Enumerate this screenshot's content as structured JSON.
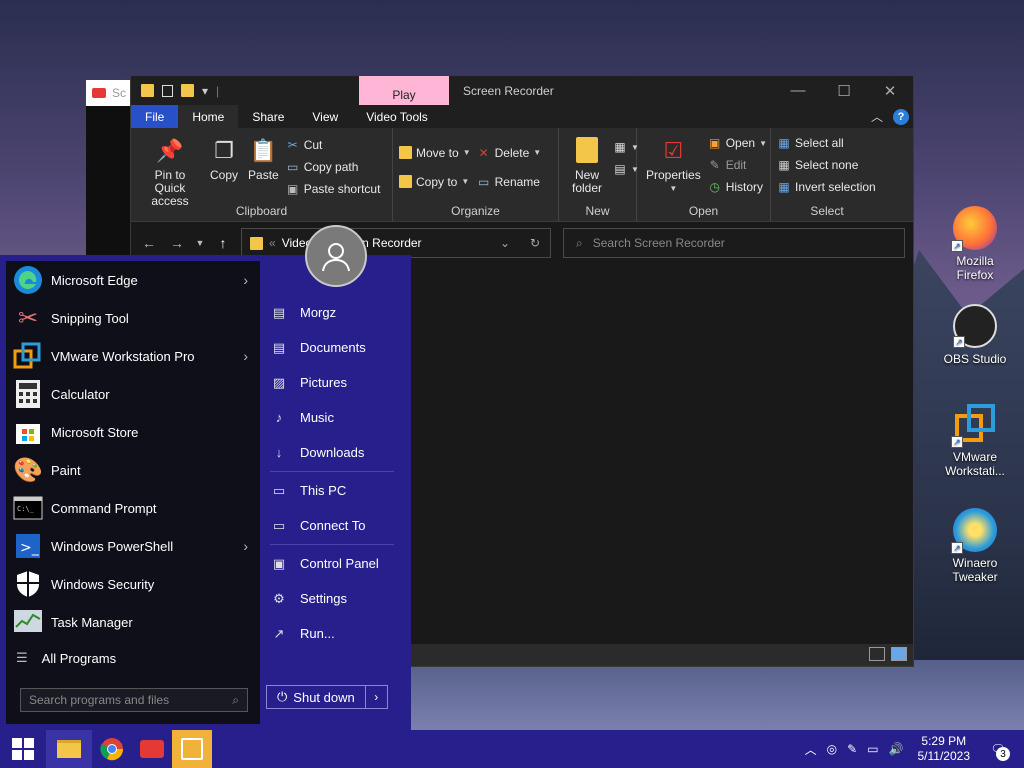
{
  "background_window": {
    "title": "Sc"
  },
  "explorer": {
    "title": "Screen Recorder",
    "context_tab": "Play",
    "tabs": {
      "file": "File",
      "home": "Home",
      "share": "Share",
      "view": "View",
      "video_tools": "Video Tools"
    },
    "clipboard": {
      "pin": "Pin to Quick access",
      "copy": "Copy",
      "paste": "Paste",
      "cut": "Cut",
      "copy_path": "Copy path",
      "paste_shortcut": "Paste shortcut",
      "label": "Clipboard"
    },
    "organize": {
      "move_to": "Move to",
      "copy_to": "Copy to",
      "delete": "Delete",
      "rename": "Rename",
      "label": "Organize"
    },
    "new": {
      "new_folder": "New folder",
      "label": "New"
    },
    "open": {
      "properties": "Properties",
      "open": "Open",
      "edit": "Edit",
      "history": "History",
      "label": "Open"
    },
    "select": {
      "select_all": "Select all",
      "select_none": "Select none",
      "invert_selection": "Invert selection",
      "label": "Select"
    },
    "address": {
      "part1": "Video",
      "part2": "n Recorder"
    },
    "search_placeholder": "Search Screen Recorder"
  },
  "start_menu": {
    "apps": [
      {
        "label": "Microsoft Edge",
        "submenu": true
      },
      {
        "label": "Snipping Tool",
        "submenu": false
      },
      {
        "label": "VMware Workstation Pro",
        "submenu": true
      },
      {
        "label": "Calculator",
        "submenu": false
      },
      {
        "label": "Microsoft Store",
        "submenu": false
      },
      {
        "label": "Paint",
        "submenu": false
      },
      {
        "label": "Command Prompt",
        "submenu": false
      },
      {
        "label": "Windows PowerShell",
        "submenu": true
      },
      {
        "label": "Windows Security",
        "submenu": false
      },
      {
        "label": "Task Manager",
        "submenu": false
      }
    ],
    "all_programs": "All Programs",
    "search_placeholder": "Search programs and files",
    "places": {
      "user": "Morgz",
      "documents": "Documents",
      "pictures": "Pictures",
      "music": "Music",
      "downloads": "Downloads",
      "this_pc": "This PC",
      "connect_to": "Connect To",
      "control_panel": "Control Panel",
      "settings": "Settings",
      "run": "Run..."
    },
    "shut_down": "Shut down"
  },
  "desktop_icons": {
    "firefox": "Mozilla Firefox",
    "obs": "OBS Studio",
    "vmware": "VMware Workstati...",
    "winaero": "Winaero Tweaker"
  },
  "taskbar": {
    "time": "5:29 PM",
    "date": "5/11/2023",
    "notification_count": "3"
  },
  "colors": {
    "accent": "#27208c",
    "file_tab": "#2850c8",
    "context_tab": "#ffb6d6"
  }
}
